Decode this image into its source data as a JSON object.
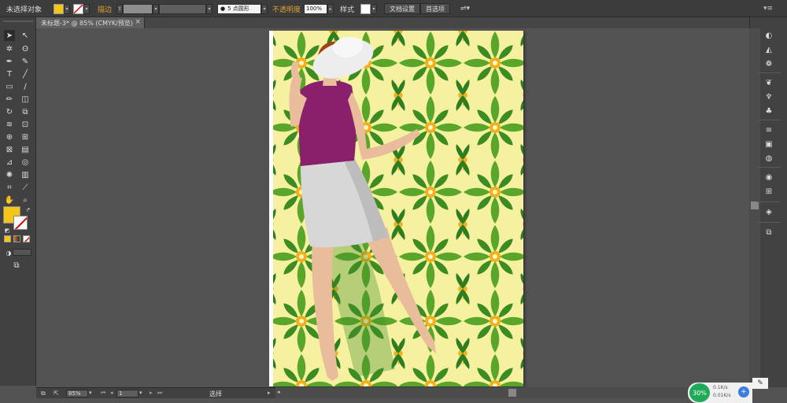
{
  "control_bar": {
    "selection_label": "未选择对象",
    "fill_color": "#f5c518",
    "stroke_label": "描边",
    "stroke_label_color": "#e0a030",
    "brush_value": "5 点圆形",
    "opacity_label": "不透明度",
    "opacity_value": "100%",
    "style_label": "样式",
    "doc_setup_button": "文档设置",
    "preferences_button": "首选项"
  },
  "document_tab": {
    "title": "未标题-3* @ 85% (CMYK/预览)",
    "close": "×"
  },
  "status_bar": {
    "zoom_value": "85%",
    "page_value": "1",
    "tool_label": "选择"
  },
  "net_widget": {
    "percent": "30%",
    "upload": "0.1K/s",
    "download": "0.01K/s"
  },
  "colors": {
    "fill_swatch": "#f5c518",
    "pattern_bg": "#f6f1a0",
    "pattern_green": "#5aa62a",
    "pattern_dark": "#2e7d1e",
    "pattern_yellow": "#f4b018",
    "shirt": "#8a1f6b",
    "skirt": "#d7d7d7",
    "skin": "#e9bc9b",
    "hair": "#a04414",
    "hat": "#ededed"
  }
}
